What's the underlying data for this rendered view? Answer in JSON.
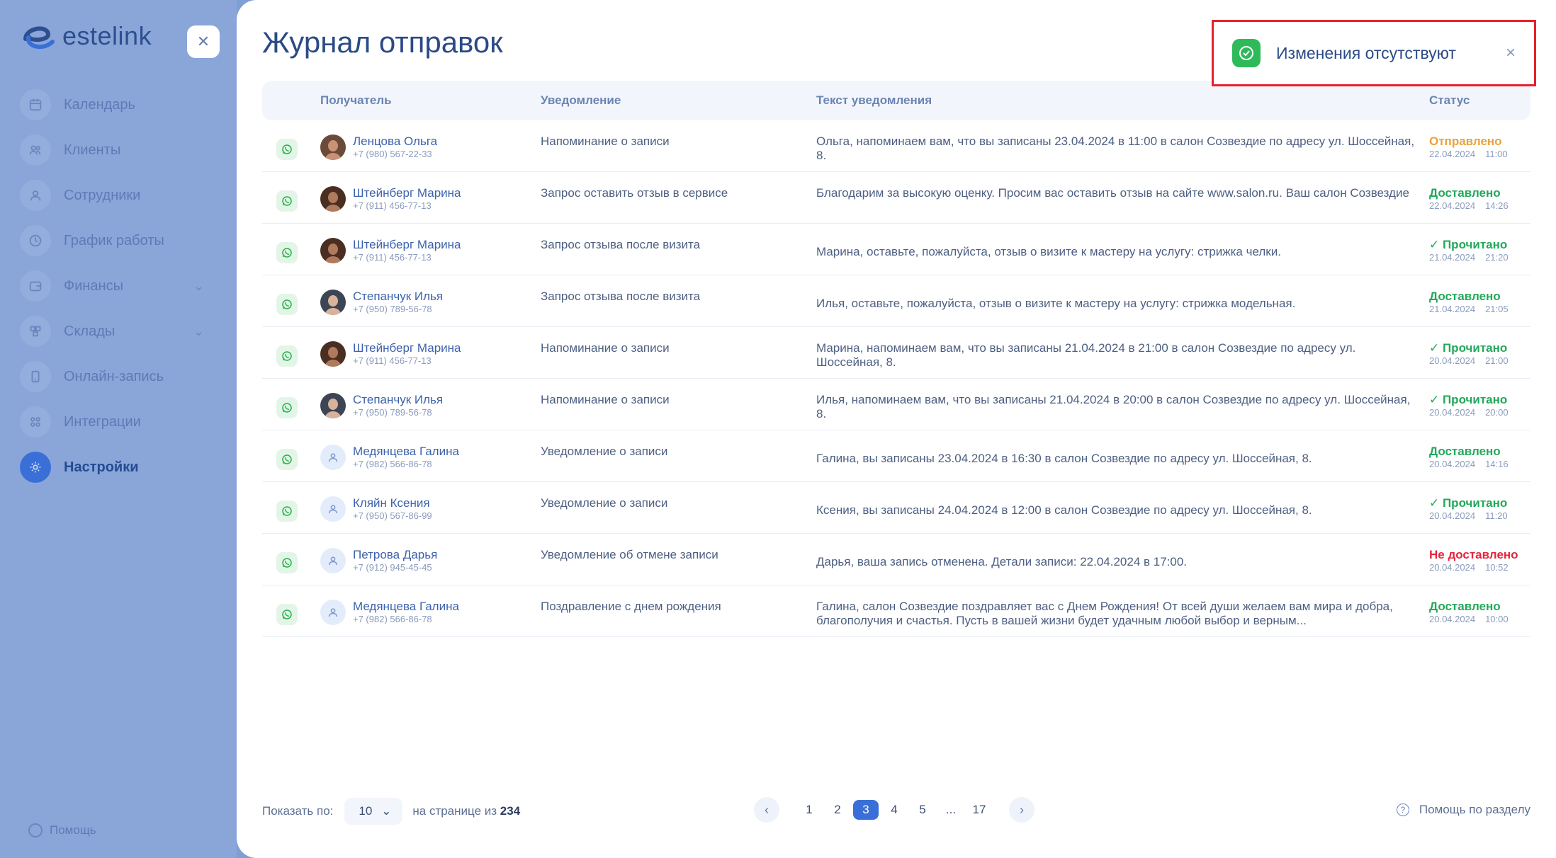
{
  "brand": {
    "logo_text": "estelink"
  },
  "sidebar": {
    "items": [
      {
        "label": "Календарь",
        "icon": "calendar-icon"
      },
      {
        "label": "Клиенты",
        "icon": "clients-icon"
      },
      {
        "label": "Сотрудники",
        "icon": "staff-icon"
      },
      {
        "label": "График работы",
        "icon": "clock-icon"
      },
      {
        "label": "Финансы",
        "icon": "wallet-icon",
        "has_children": true
      },
      {
        "label": "Склады",
        "icon": "boxes-icon",
        "has_children": true
      },
      {
        "label": "Онлайн-запись",
        "icon": "phone-icon"
      },
      {
        "label": "Интеграции",
        "icon": "integrations-icon"
      },
      {
        "label": "Настройки",
        "icon": "gear-icon",
        "active": true
      }
    ],
    "help_label": "Помощь"
  },
  "page": {
    "title": "Журнал отправок"
  },
  "table": {
    "headers": {
      "recipient": "Получатель",
      "notification": "Уведомление",
      "text": "Текст уведомления",
      "status": "Статус"
    },
    "rows": [
      {
        "name": "Ленцова Ольга",
        "phone": "+7 (980) 567-22-33",
        "avatar": "photo-f1",
        "notification": "Напоминание о записи",
        "text": "Ольга, напоминаем вам, что вы записаны 23.04.2024 в 11:00 в салон Созвездие по адресу ул. Шоссейная, 8.",
        "status": "Отправлено",
        "status_color": "#e8a33a",
        "date": "22.04.2024",
        "time": "11:00"
      },
      {
        "name": "Штейнберг Марина",
        "phone": "+7 (911) 456-77-13",
        "avatar": "photo-f2",
        "notification": "Запрос оставить отзыв в сервисе",
        "text": "Благодарим за высокую оценку. Просим вас оставить отзыв на сайте www.salon.ru. Ваш салон Созвездие",
        "status": "Доставлено",
        "status_color": "#22a85a",
        "date": "22.04.2024",
        "time": "14:26"
      },
      {
        "name": "Штейнберг Марина",
        "phone": "+7 (911) 456-77-13",
        "avatar": "photo-f2",
        "notification": "Запрос отзыва после визита",
        "text": "Марина, оставьте, пожалуйста, отзыв о визите к мастеру на услугу: стрижка челки.",
        "status": "✓ Прочитано",
        "status_color": "#22a85a",
        "date": "21.04.2024",
        "time": "21:20"
      },
      {
        "name": "Степанчук Илья",
        "phone": "+7 (950) 789-56-78",
        "avatar": "photo-m1",
        "notification": "Запрос отзыва после визита",
        "text": "Илья, оставьте, пожалуйста, отзыв о визите к мастеру на услугу: стрижка модельная.",
        "status": "Доставлено",
        "status_color": "#22a85a",
        "date": "21.04.2024",
        "time": "21:05"
      },
      {
        "name": "Штейнберг Марина",
        "phone": "+7 (911) 456-77-13",
        "avatar": "photo-f2",
        "notification": "Напоминание о записи",
        "text": "Марина, напоминаем вам, что вы записаны 21.04.2024 в 21:00 в салон Созвездие по адресу ул. Шоссейная, 8.",
        "status": "✓ Прочитано",
        "status_color": "#22a85a",
        "date": "20.04.2024",
        "time": "21:00"
      },
      {
        "name": "Степанчук Илья",
        "phone": "+7 (950) 789-56-78",
        "avatar": "photo-m1",
        "notification": "Напоминание о записи",
        "text": "Илья, напоминаем вам, что вы записаны 21.04.2024 в 20:00 в салон Созвездие по адресу ул. Шоссейная, 8.",
        "status": "✓ Прочитано",
        "status_color": "#22a85a",
        "date": "20.04.2024",
        "time": "20:00"
      },
      {
        "name": "Медянцева Галина",
        "phone": "+7 (982) 566-86-78",
        "avatar": "placeholder",
        "notification": "Уведомление о записи",
        "text": "Галина, вы записаны 23.04.2024 в 16:30 в салон Созвездие по адресу ул. Шоссейная, 8.",
        "status": "Доставлено",
        "status_color": "#22a85a",
        "date": "20.04.2024",
        "time": "14:16"
      },
      {
        "name": "Кляйн Ксения",
        "phone": "+7 (950) 567-86-99",
        "avatar": "placeholder",
        "notification": "Уведомление о записи",
        "text": "Ксения, вы записаны 24.04.2024 в 12:00 в салон Созвездие по адресу ул. Шоссейная, 8.",
        "status": "✓ Прочитано",
        "status_color": "#22a85a",
        "date": "20.04.2024",
        "time": "11:20"
      },
      {
        "name": "Петрова Дарья",
        "phone": "+7 (912) 945-45-45",
        "avatar": "placeholder",
        "notification": "Уведомление об отмене записи",
        "text": "Дарья, ваша запись отменена. Детали записи: 22.04.2024 в 17:00.",
        "status": "Не доставлено",
        "status_color": "#e5243b",
        "date": "20.04.2024",
        "time": "10:52"
      },
      {
        "name": "Медянцева Галина",
        "phone": "+7 (982) 566-86-78",
        "avatar": "placeholder",
        "notification": "Поздравление с днем рождения",
        "text": "Галина, салон Созвездие поздравляет вас с Днем Рождения! От всей души желаем вам мира и добра, благополучия и счастья. Пусть в вашей жизни будет удачным любой выбор и верным...",
        "status": "Доставлено",
        "status_color": "#22a85a",
        "date": "20.04.2024",
        "time": "10:00"
      }
    ]
  },
  "footer": {
    "show_label": "Показать по:",
    "per_page": "10",
    "of_label": "на странице из",
    "total": "234",
    "pages": [
      "1",
      "2",
      "3",
      "4",
      "5",
      "...",
      "17"
    ],
    "active_page": "3",
    "help_label": "Помощь по разделу"
  },
  "toast": {
    "message": "Изменения отсутствуют",
    "close": "×"
  },
  "colors": {
    "accent": "#3a6fd8",
    "success": "#2fba5a",
    "whatsapp": "#25b14a"
  }
}
